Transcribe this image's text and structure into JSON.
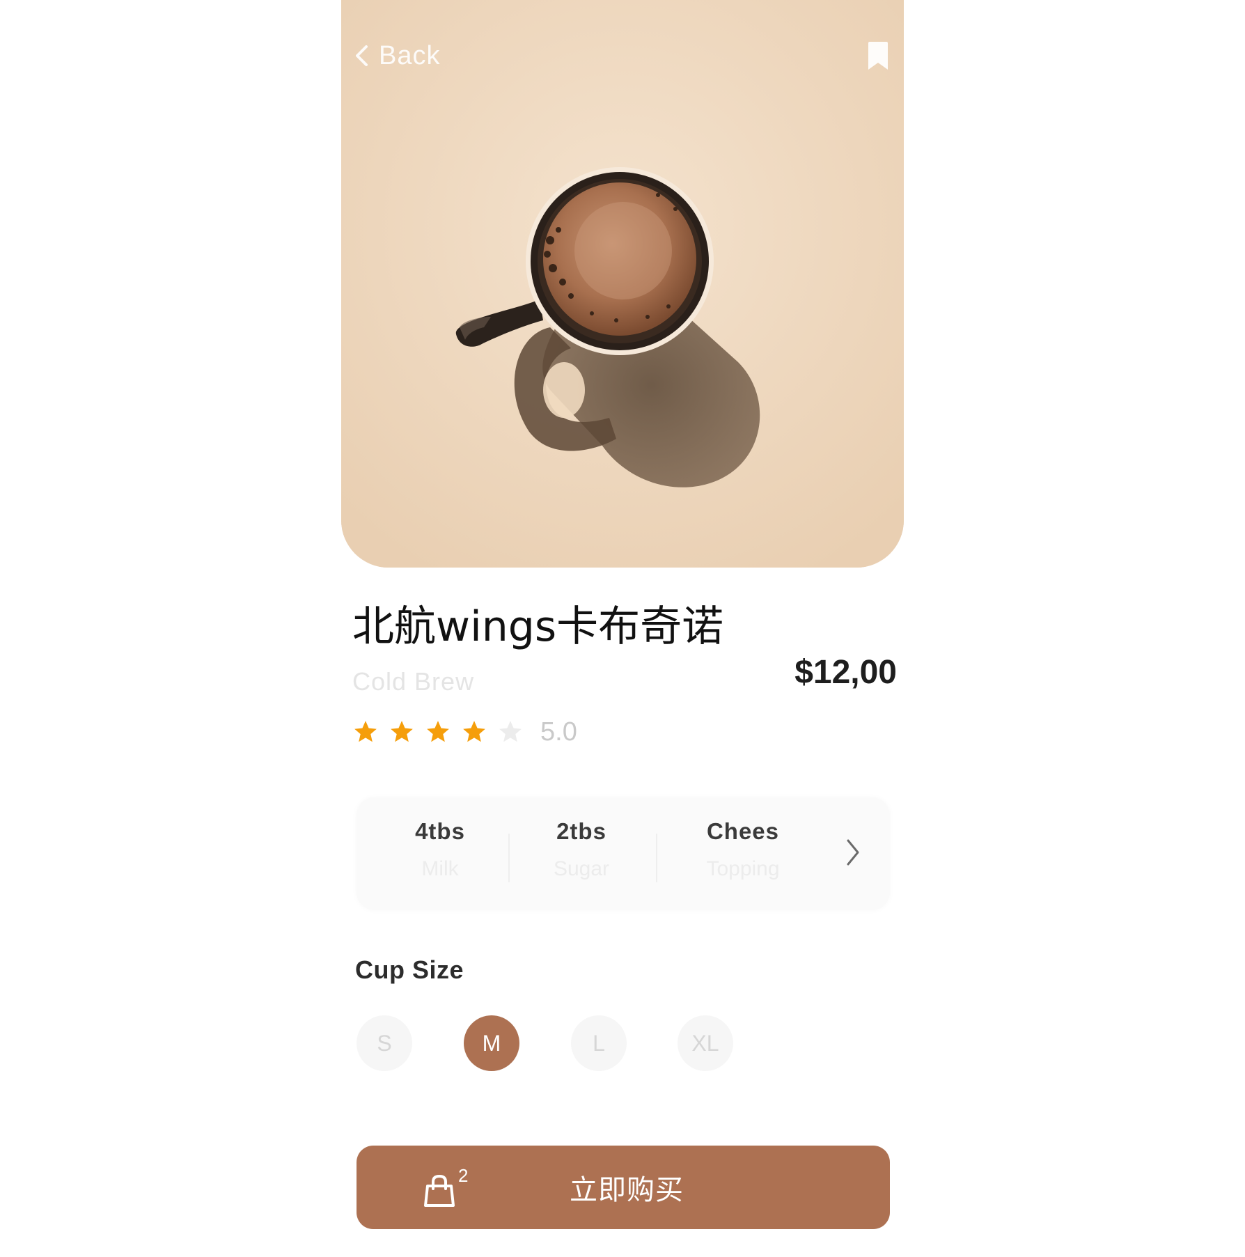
{
  "header": {
    "back_label": "Back",
    "back_icon": "chevron-left-icon",
    "bookmark_icon": "bookmark-icon"
  },
  "product": {
    "title": "北航wings卡布奇诺",
    "subtitle": "Cold Brew",
    "price": "$12,00",
    "rating": {
      "value": "5.0",
      "filled_stars": 4,
      "total_stars": 5,
      "star_color": "#f59e0b",
      "empty_star_color": "#ececec"
    }
  },
  "options": {
    "items": [
      {
        "value": "4tbs",
        "label": "Milk"
      },
      {
        "value": "2tbs",
        "label": "Sugar"
      },
      {
        "value": "Chees",
        "label": "Topping"
      }
    ],
    "next_icon": "chevron-right-icon"
  },
  "cup_size": {
    "label": "Cup Size",
    "options": [
      "S",
      "M",
      "L",
      "XL"
    ],
    "selected": "M"
  },
  "buy_button": {
    "label": "立即购买",
    "cart_icon": "shopping-bag-icon",
    "cart_count": "2"
  },
  "colors": {
    "accent": "#ad7152",
    "hero_background": "#efd9bf",
    "text_primary": "#111111"
  }
}
